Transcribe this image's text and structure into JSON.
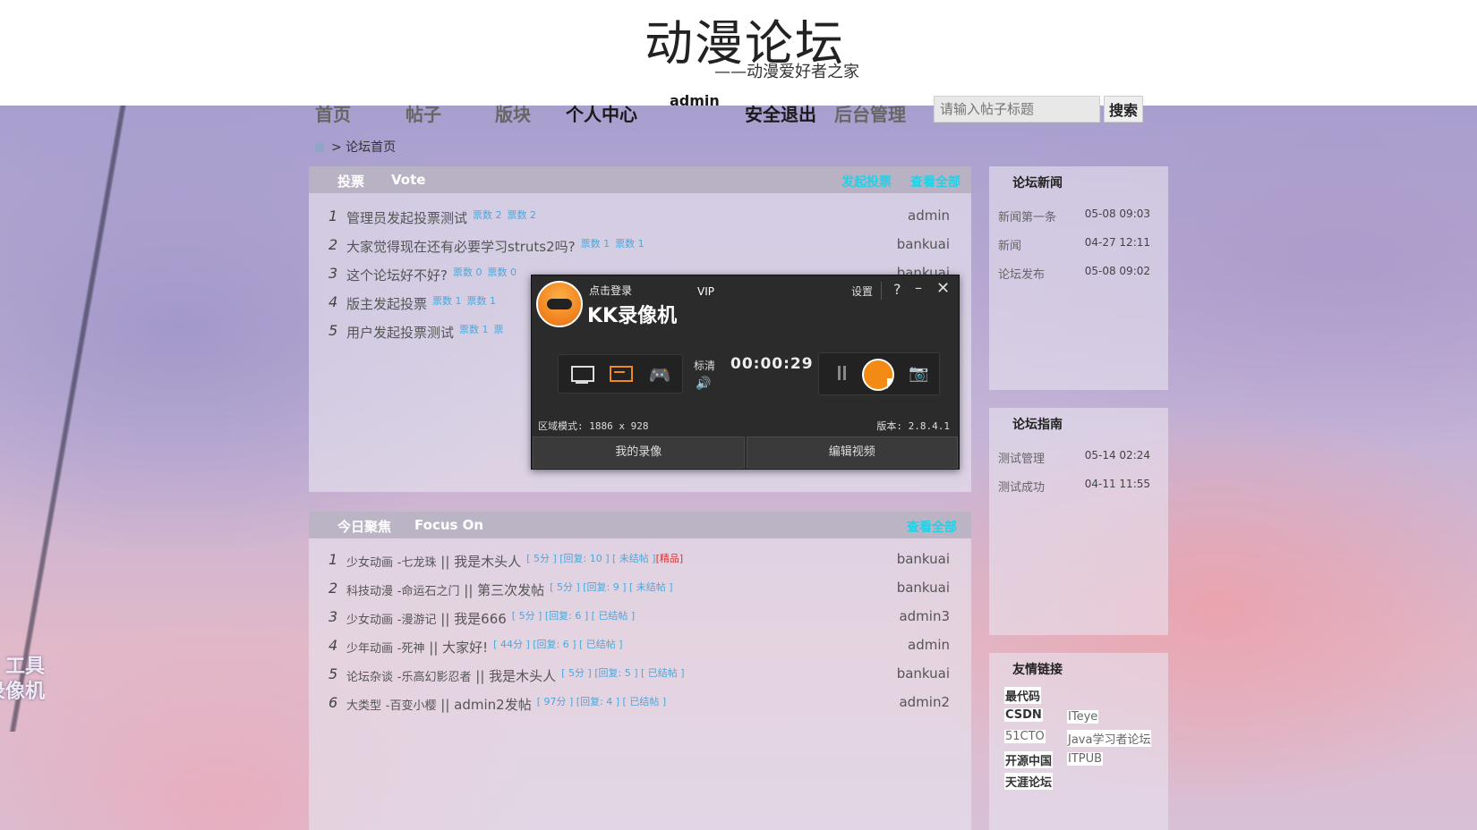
{
  "header": {
    "title": "动漫论坛",
    "subtitle": "——动漫爱好者之家"
  },
  "nav": {
    "items": [
      "首页",
      "帖子",
      "版块",
      "个人中心",
      "安全退出",
      "后台管理"
    ],
    "user": "admin",
    "search_placeholder": "请输入帖子标题",
    "search_button": "搜索"
  },
  "breadcrumb": {
    "label": "> 论坛首页"
  },
  "vote": {
    "title_cn": "投票",
    "title_en": "Vote",
    "action": "发起投票",
    "view_all": "查看全部",
    "rows": [
      {
        "num": "1",
        "title": "管理员发起投票测试",
        "meta": [
          "票数 2",
          "票数 2"
        ],
        "author": "admin"
      },
      {
        "num": "2",
        "title": "大家觉得现在还有必要学习struts2吗?",
        "meta": [
          "票数 1",
          "票数 1"
        ],
        "author": "bankuai"
      },
      {
        "num": "3",
        "title": "这个论坛好不好?",
        "meta": [
          "票数 0",
          "票数 0"
        ],
        "author": "bankuai"
      },
      {
        "num": "4",
        "title": "版主发起投票",
        "meta": [
          "票数 1",
          "票数 1"
        ],
        "author": ""
      },
      {
        "num": "5",
        "title": "用户发起投票测试",
        "meta": [
          "票数 1",
          "票"
        ],
        "author": ""
      }
    ]
  },
  "focus": {
    "title_cn": "今日聚焦",
    "title_en": "Focus On",
    "view_all": "查看全部",
    "rows": [
      {
        "num": "1",
        "category": "少女动画",
        "board": "-七龙珠",
        "title": "我是木头人",
        "meta": "[ 5分 ] [回复: 10 ] [ 未结帖 ]",
        "tag": "[精品]",
        "author": "bankuai"
      },
      {
        "num": "2",
        "category": "科技动漫",
        "board": "-命运石之门",
        "title": "第三次发帖",
        "meta": "[ 5分 ] [回复: 9 ] [ 未结帖 ]",
        "tag": "",
        "author": "bankuai"
      },
      {
        "num": "3",
        "category": "少女动画",
        "board": "-漫游记",
        "title": "我是666",
        "meta": "[ 5分 ] [回复: 6 ] [ 已结帖 ]",
        "tag": "",
        "author": "admin3"
      },
      {
        "num": "4",
        "category": "少年动画",
        "board": "-死神",
        "title": "大家好!",
        "meta": "[ 44分 ] [回复: 6 ] [ 已结帖 ]",
        "tag": "",
        "author": "admin"
      },
      {
        "num": "5",
        "category": "论坛杂谈",
        "board": "-乐高幻影忍者",
        "title": "我是木头人",
        "meta": "[ 5分 ] [回复: 5 ] [ 已结帖 ]",
        "tag": "",
        "author": "bankuai"
      },
      {
        "num": "6",
        "category": "大类型",
        "board": "-百变小樱",
        "title": "admin2发帖",
        "meta": "[ 97分 ] [回复: 4 ] [ 已结帖 ]",
        "tag": "",
        "author": "admin2"
      }
    ]
  },
  "news": {
    "title": "论坛新闻",
    "items": [
      {
        "title": "新闻第一条",
        "date": "05-08 09:03"
      },
      {
        "title": "新闻",
        "date": "04-27 12:11"
      },
      {
        "title": "论坛发布",
        "date": "05-08 09:02"
      }
    ]
  },
  "guide": {
    "title": "论坛指南",
    "items": [
      {
        "title": "测试管理",
        "date": "05-14 02:24"
      },
      {
        "title": "测试成功",
        "date": "04-11 11:55"
      }
    ]
  },
  "friend_links": {
    "title": "友情链接",
    "items": [
      "最代码",
      "CSDN",
      "ITeye",
      "51CTO",
      "Java学习者论坛",
      "开源中国",
      "ITPUB",
      "天涯论坛"
    ]
  },
  "recorder": {
    "login": "点击登录",
    "vip": "VIP",
    "name": "KK录像机",
    "settings": "设置",
    "help": "?",
    "minimize": "–",
    "close": "✕",
    "quality": "标清",
    "timer": "00:00:29",
    "region_mode": "区域模式: 1886 x 928",
    "version": "版本: 2.8.4.1",
    "my_videos": "我的录像",
    "edit_video": "编辑视频"
  },
  "watermark": {
    "line1": "工具",
    "line2": "录像机"
  }
}
